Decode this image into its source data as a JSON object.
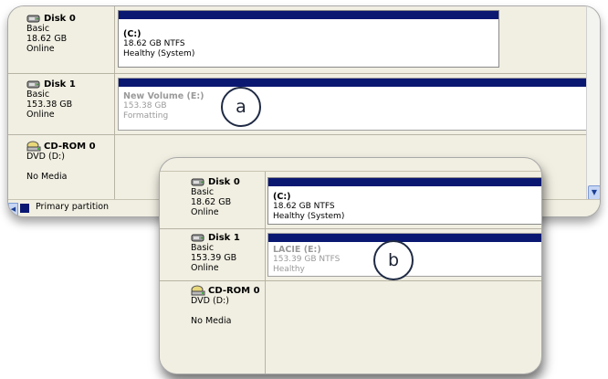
{
  "panel_a": {
    "disks": [
      {
        "title": "Disk 0",
        "lines": [
          "Basic",
          "18.62 GB",
          "Online"
        ],
        "volume": {
          "name": "(C:)",
          "size": "18.62 GB NTFS",
          "status": "Healthy (System)"
        }
      },
      {
        "title": "Disk 1",
        "lines": [
          "Basic",
          "153.38 GB",
          "Online"
        ],
        "volume": {
          "name": "New Volume  (E:)",
          "size": "153.38 GB",
          "status": "Formatting"
        }
      },
      {
        "title": "CD-ROM 0",
        "lines": [
          "DVD (D:)",
          "",
          "No Media"
        ]
      }
    ],
    "callout": "a",
    "legend": "Primary partition"
  },
  "panel_b": {
    "disks": [
      {
        "title": "Disk 0",
        "lines": [
          "Basic",
          "18.62 GB",
          "Online"
        ],
        "volume": {
          "name": "(C:)",
          "size": "18.62 GB NTFS",
          "status": "Healthy (System)"
        }
      },
      {
        "title": "Disk 1",
        "lines": [
          "Basic",
          "153.39 GB",
          "Online"
        ],
        "volume": {
          "name": "LACIE  (E:)",
          "size": "153.39 GB NTFS",
          "status": "Healthy"
        }
      },
      {
        "title": "CD-ROM 0",
        "lines": [
          "DVD (D:)",
          "",
          "No Media"
        ]
      }
    ],
    "callout": "b"
  },
  "colors": {
    "partition_bar": "#0a1872",
    "panel_bg": "#f1efe2"
  },
  "icons": {
    "disk": "hard-disk-icon",
    "cdrom": "cdrom-icon"
  }
}
